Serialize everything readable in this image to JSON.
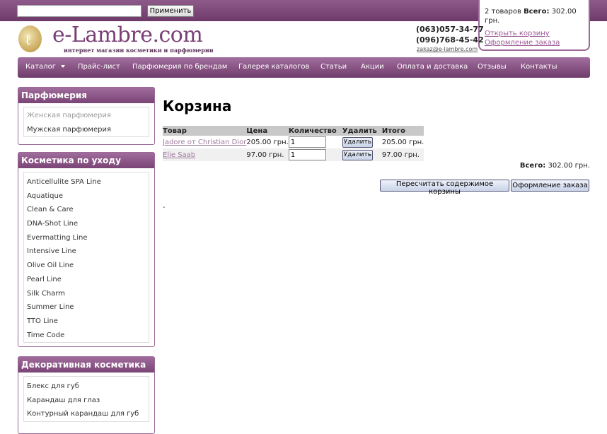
{
  "search": {
    "value": "",
    "apply_label": "Применить"
  },
  "cart": {
    "count_text": "2 товаров",
    "total_label": "Всего:",
    "total_value": "302.00 грн.",
    "open_link": "Открыть корзину",
    "checkout_link": "Оформление заказа"
  },
  "logo": {
    "name": "e-Lambre.com",
    "tagline": "интернет магазин косметики и парфюмерии"
  },
  "contacts": {
    "phone1": "(063)057-34-77",
    "phone2": "(096)768-45-42",
    "email": "zakaz@e-lambre.com"
  },
  "nav": [
    "Каталог",
    "Прайс-лист",
    "Парфюмерия по брендам",
    "Галерея каталогов",
    "Статьи",
    "Акции",
    "Оплата и доставка",
    "Отзывы",
    "Контакты"
  ],
  "sidebar": [
    {
      "title": "Парфюмерия",
      "items": [
        "Женская парфюмерия",
        "Мужская парфюмерия"
      ]
    },
    {
      "title": "Косметика по уходу",
      "items": [
        "Anticellulite SPA Line",
        "Aquatique",
        "Clean & Care",
        "DNA-Shot Line",
        "Evermatting Line",
        "Intensive Line",
        "Olive Oil Line",
        "Pearl Line",
        "Silk Charm",
        "Summer Line",
        "TTO Line",
        "Time Code"
      ]
    },
    {
      "title": "Декоративная косметика",
      "items": [
        "Блекс для губ",
        "Карандаш для глаз",
        "Контурный карандаш для губ"
      ]
    }
  ],
  "main": {
    "title": "Корзина",
    "table": {
      "headers": [
        "Товар",
        "Цена",
        "Количество",
        "Удалить",
        "Итого"
      ],
      "rows": [
        {
          "product": "Jadore от Christian Dior",
          "price": "205.00 грн.",
          "qty": "1",
          "delete_label": "Удалить",
          "total": "205.00 грн."
        },
        {
          "product": "Elie Saab",
          "price": "97.00 грн.",
          "qty": "1",
          "delete_label": "Удалить",
          "total": "97.00 грн."
        }
      ]
    },
    "total_label": "Всего:",
    "total_value": "302.00 грн.",
    "recalc_label": "Пересчитать содержимое корзины",
    "checkout_label": "Оформление заказа",
    "dash": "-"
  }
}
